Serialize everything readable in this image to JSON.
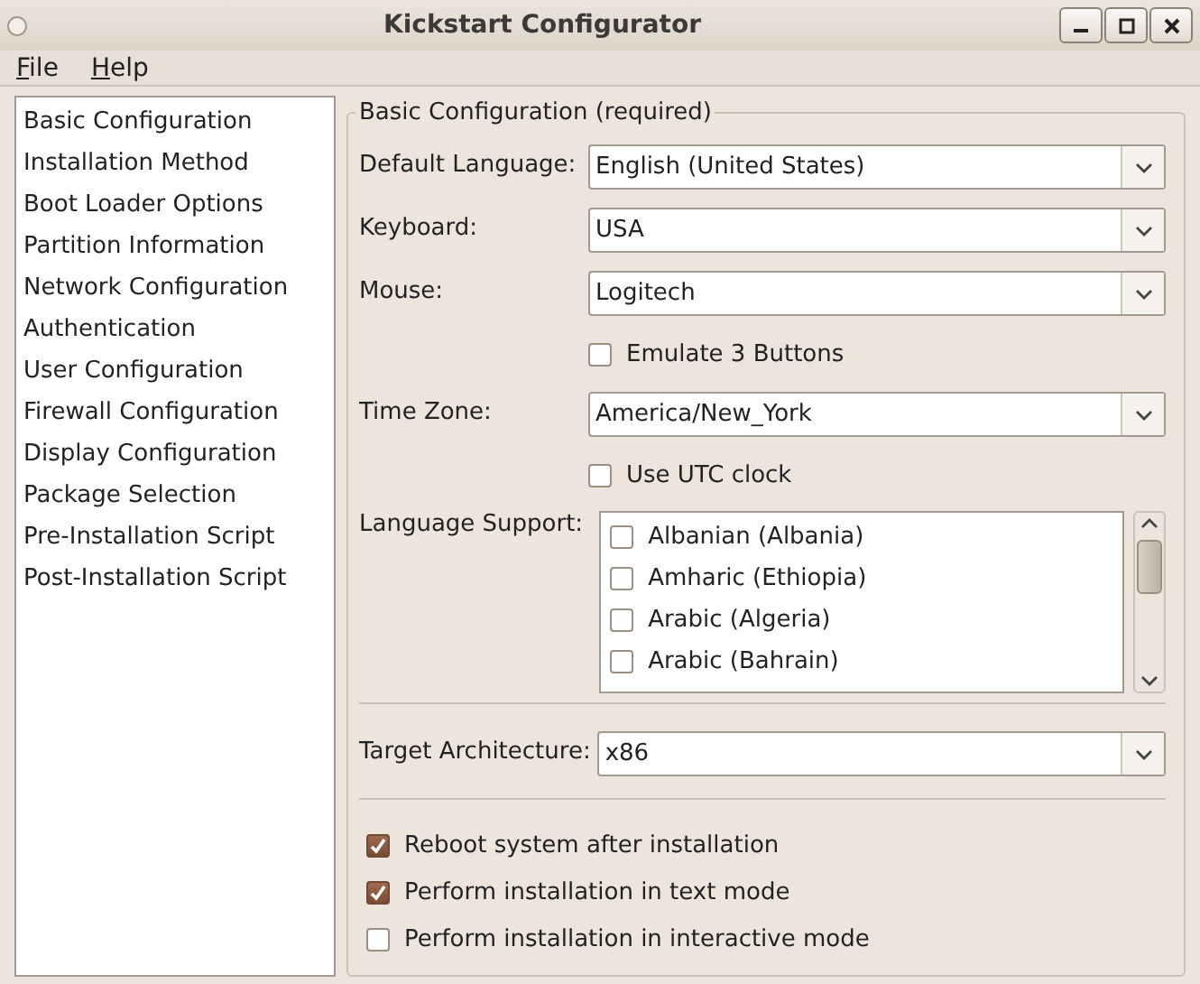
{
  "window": {
    "title": "Kickstart Configurator"
  },
  "menu": [
    "File",
    "Help"
  ],
  "sidebar": {
    "items": [
      "Basic Configuration",
      "Installation Method",
      "Boot Loader Options",
      "Partition Information",
      "Network Configuration",
      "Authentication",
      "User Configuration",
      "Firewall Configuration",
      "Display Configuration",
      "Package Selection",
      "Pre-Installation Script",
      "Post-Installation Script"
    ]
  },
  "section": {
    "title": "Basic Configuration (required)",
    "fields": [
      {
        "kind": "combo",
        "label": "Default Language:",
        "value": "English (United States)"
      },
      {
        "kind": "combo",
        "label": "Keyboard:",
        "value": "USA"
      },
      {
        "kind": "combo",
        "label": "Mouse:",
        "value": "Logitech"
      },
      {
        "kind": "check",
        "label": "Emulate 3 Buttons",
        "checked": false
      },
      {
        "kind": "combo",
        "label": "Time Zone:",
        "value": "America/New_York"
      },
      {
        "kind": "check",
        "label": "Use UTC clock",
        "checked": false
      }
    ],
    "language_support": {
      "label": "Language Support:",
      "items": [
        {
          "label": "Albanian (Albania)",
          "checked": false
        },
        {
          "label": "Amharic (Ethiopia)",
          "checked": false
        },
        {
          "label": "Arabic (Algeria)",
          "checked": false
        },
        {
          "label": "Arabic (Bahrain)",
          "checked": false
        }
      ]
    },
    "target_architecture": {
      "label": "Target Architecture:",
      "value": "x86"
    },
    "options": [
      {
        "label": "Reboot system after installation",
        "checked": true
      },
      {
        "label": "Perform installation in text mode",
        "checked": true
      },
      {
        "label": "Perform installation in interactive mode",
        "checked": false
      }
    ]
  }
}
